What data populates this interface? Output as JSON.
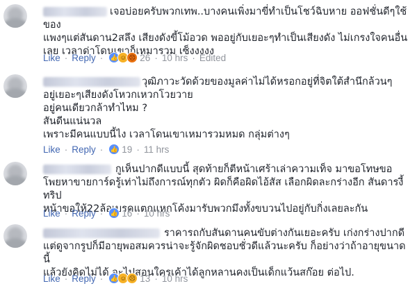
{
  "comments": [
    {
      "text_first": "เจอบ่อยครับพวกเทพ..บางคนเพิ่งมาขี่ทำเป็นโชว์ฉิบหาย ออฟชั่นดีๆใช้ของ",
      "text_rest": "แพงๆแต่สันดาน2สลึง เสียงดังขี้โม้อวด พออยู่กับเยอะๆทำเป็นเสียงดัง ไม่เกรงใจคนอื่น\nเลย เวลาด่าโดนเขาก็เหมารวม เซ็งงงงง",
      "like_label": "Like",
      "reply_label": "Reply",
      "reaction_icons": [
        "like-icon",
        "haha-icon",
        "angry-icon"
      ],
      "count": "26",
      "time": "10 hrs",
      "edited": "Edited"
    },
    {
      "text_first": "วุฒิภาวะวัดด้วยของมูลค่าไม่ได้หรอกอยู่ที่จิตใต้สำนึกล้วนๆ",
      "text_rest": "อยู่เยอะๆเสียงดังโหวกเหวกโวยวาย\nอยู่คนเดียวกล้าทำไหม ?\nสันดีนแน่นวล\nเพราะมีคนแบบนี้ไง เวลาโดนเขาเหมารวมหมด กลุ่มต่างๆ",
      "like_label": "Like",
      "reply_label": "Reply",
      "reaction_icons": [
        "like-icon"
      ],
      "count": "19",
      "time": "11 hrs"
    },
    {
      "text_first": "กูเห็นปากดีแบบนี้ สุดท้ายก็ตีหน้าเศร้าเล่าความเท็จ มาขอโทษขอ",
      "text_rest": "โพยหาขายการ์ดรู้เท่าไม่ถึงการณ์ทุกตัว ผิดก็คือผิดไอ้สัส เลือกผิดละกร่างอีก สันดารงี้ทริป\nหน้าขอให้22ล้อเบรคแตกแหกโค้งมารับพวกมึงทั้งขบวนไปอยู่กับกิ่งเลยละกัน",
      "like_label": "Like",
      "reply_label": "Reply",
      "reaction_icons": [
        "like-icon"
      ],
      "count": "16",
      "time": "10 hrs"
    },
    {
      "text_first": "ราคารถกับสันดานคนขับต่างกันเยอะครับ เก่งกร่างปากดี",
      "text_rest": "แต่ดูจากรูปก็มีอายุพอสมควรน่าจะรู้จักผิดชอบชั่วดีแล้วนะครับ ก็อย่างว่าถ้าอายุขนาดนี้\nแล้วยังคิดไม่ได้ จะไปสอนใครเค้าได้ลูกหลานคงเป็นเด็กแว้นสก๊อย ต่อไป.",
      "like_label": "Like",
      "reply_label": "Reply",
      "reaction_icons": [
        "like-icon",
        "haha-icon",
        "sad-icon"
      ],
      "count": "13",
      "time": "10 hrs"
    }
  ]
}
